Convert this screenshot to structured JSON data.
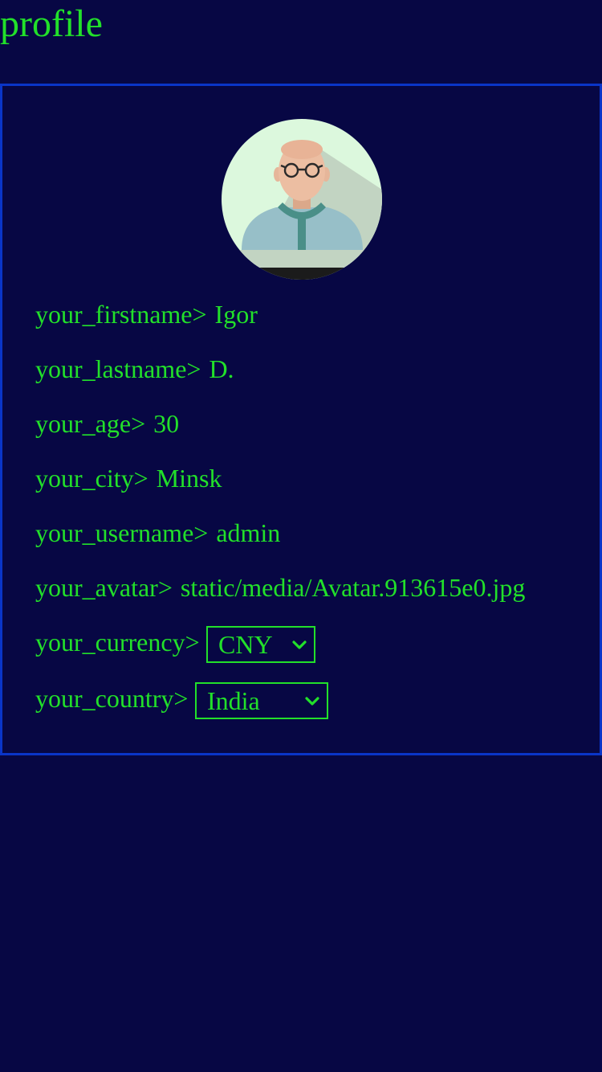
{
  "page": {
    "title": "profile"
  },
  "profile": {
    "fields": [
      {
        "label": "your_firstname>",
        "value": "Igor"
      },
      {
        "label": "your_lastname>",
        "value": "D."
      },
      {
        "label": "your_age>",
        "value": "30"
      },
      {
        "label": "your_city>",
        "value": "Minsk"
      },
      {
        "label": "your_username>",
        "value": "admin"
      },
      {
        "label": "your_avatar>",
        "value": "static/media/Avatar.913615e0.jpg"
      }
    ],
    "currency": {
      "label": "your_currency>",
      "selected": "CNY"
    },
    "country": {
      "label": "your_country>",
      "selected": "India"
    }
  },
  "icons": {
    "avatar": "person-with-glasses",
    "select_chevron": "chevron-down-icon"
  },
  "colors": {
    "background": "#070744",
    "text": "#22e02a",
    "card_border": "#0a35c8"
  }
}
